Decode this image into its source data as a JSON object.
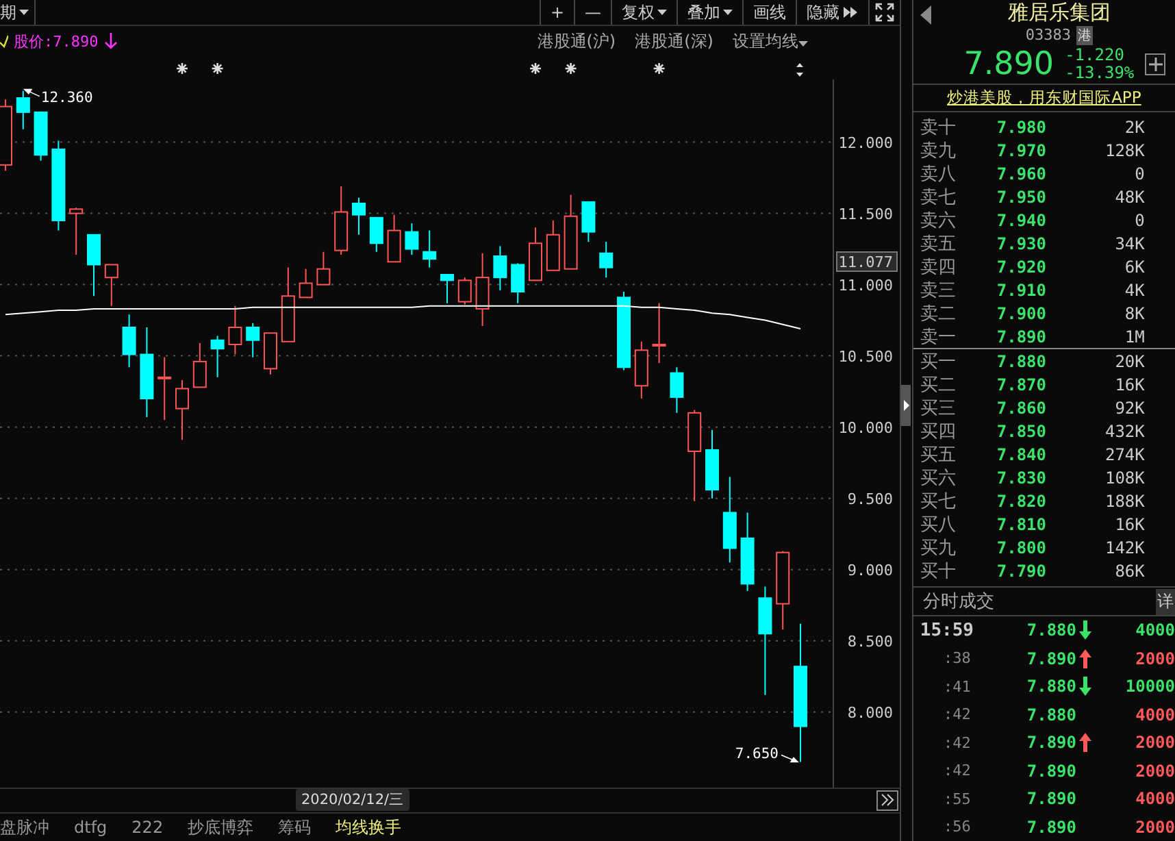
{
  "toolbar": {
    "period_dropdown": "期",
    "buttons": [
      {
        "label": "+",
        "kind": "plain"
      },
      {
        "label": "—",
        "kind": "plain"
      },
      {
        "label": "复权",
        "kind": "dropdown"
      },
      {
        "label": "叠加",
        "kind": "dropdown"
      },
      {
        "label": "画线",
        "kind": "plain"
      },
      {
        "label": "隐藏",
        "kind": "hide"
      },
      {
        "kind": "fullscreen"
      }
    ]
  },
  "legend": {
    "price_label": "股价:7.890",
    "links": [
      {
        "label": "港股通(沪)",
        "kind": "plain"
      },
      {
        "label": "港股通(深)",
        "kind": "plain"
      },
      {
        "label": "设置均线",
        "kind": "dropdown"
      }
    ]
  },
  "chart": {
    "chart_data": {
      "type": "candlestick",
      "grid": true,
      "ylim": [
        7.47,
        12.44
      ],
      "yticks": [
        {
          "value": 12,
          "label": "12.000"
        },
        {
          "value": 11.5,
          "label": "11.500"
        },
        {
          "value": 11,
          "label": "11.000"
        },
        {
          "value": 10.5,
          "label": "10.500"
        },
        {
          "value": 10,
          "label": "10.000"
        },
        {
          "value": 9.5,
          "label": "9.500"
        },
        {
          "value": 9,
          "label": "9.000"
        },
        {
          "value": 8.5,
          "label": "8.500"
        },
        {
          "value": 8,
          "label": "8.000"
        }
      ],
      "ohlc": [
        [
          11.84,
          12.3,
          11.8,
          12.25
        ],
        [
          12.31,
          12.36,
          12.09,
          12.21
        ],
        [
          12.21,
          12.21,
          11.87,
          11.91
        ],
        [
          11.95,
          12.01,
          11.38,
          11.45
        ],
        [
          11.5,
          11.54,
          11.21,
          11.53
        ],
        [
          11.35,
          11.35,
          10.92,
          11.14
        ],
        [
          11.05,
          11.14,
          10.85,
          11.14
        ],
        [
          10.7,
          10.79,
          10.42,
          10.51
        ],
        [
          10.51,
          10.7,
          10.07,
          10.2
        ],
        [
          10.35,
          10.49,
          10.05,
          10.35
        ],
        [
          10.13,
          10.33,
          9.91,
          10.27
        ],
        [
          10.28,
          10.59,
          10.28,
          10.46
        ],
        [
          10.61,
          10.64,
          10.35,
          10.55
        ],
        [
          10.58,
          10.85,
          10.51,
          10.7
        ],
        [
          10.7,
          10.73,
          10.49,
          10.61
        ],
        [
          10.41,
          10.66,
          10.37,
          10.66
        ],
        [
          10.6,
          11.12,
          10.6,
          10.92
        ],
        [
          10.91,
          11.11,
          10.91,
          11.01
        ],
        [
          11.0,
          11.23,
          11.0,
          11.11
        ],
        [
          11.24,
          11.69,
          11.21,
          11.51
        ],
        [
          11.57,
          11.61,
          11.35,
          11.49
        ],
        [
          11.47,
          11.47,
          11.23,
          11.29
        ],
        [
          11.16,
          11.49,
          11.16,
          11.38
        ],
        [
          11.37,
          11.43,
          11.21,
          11.25
        ],
        [
          11.23,
          11.38,
          11.12,
          11.18
        ],
        [
          11.07,
          11.07,
          10.87,
          11.03
        ],
        [
          10.88,
          11.05,
          10.86,
          11.03
        ],
        [
          10.83,
          11.22,
          10.71,
          11.05
        ],
        [
          11.2,
          11.27,
          10.96,
          11.05
        ],
        [
          11.14,
          11.15,
          10.87,
          10.95
        ],
        [
          11.03,
          11.4,
          11.03,
          11.29
        ],
        [
          11.1,
          11.45,
          11.1,
          11.35
        ],
        [
          11.11,
          11.63,
          11.11,
          11.48
        ],
        [
          11.58,
          11.58,
          11.3,
          11.37
        ],
        [
          11.22,
          11.3,
          11.05,
          11.12
        ],
        [
          10.91,
          10.95,
          10.4,
          10.42
        ],
        [
          10.29,
          10.6,
          10.2,
          10.54
        ],
        [
          10.58,
          10.87,
          10.45,
          10.58
        ],
        [
          10.38,
          10.42,
          10.1,
          10.21
        ],
        [
          9.83,
          10.12,
          9.48,
          10.1
        ],
        [
          9.84,
          9.98,
          9.5,
          9.56
        ],
        [
          9.4,
          9.65,
          9.05,
          9.15
        ],
        [
          9.22,
          9.4,
          8.85,
          8.9
        ],
        [
          8.8,
          8.88,
          8.12,
          8.55
        ],
        [
          8.76,
          9.13,
          8.58,
          9.12
        ],
        [
          8.32,
          8.62,
          7.65,
          7.9
        ]
      ],
      "series": [
        {
          "type": "line",
          "color": "#ffffff",
          "values": [
            10.79,
            10.8,
            10.81,
            10.82,
            10.82,
            10.83,
            10.83,
            10.83,
            10.83,
            10.83,
            10.83,
            10.83,
            10.83,
            10.83,
            10.84,
            10.84,
            10.84,
            10.84,
            10.84,
            10.84,
            10.84,
            10.84,
            10.84,
            10.84,
            10.85,
            10.85,
            10.85,
            10.85,
            10.85,
            10.85,
            10.85,
            10.85,
            10.85,
            10.85,
            10.85,
            10.85,
            10.84,
            10.84,
            10.83,
            10.82,
            10.8,
            10.79,
            10.77,
            10.75,
            10.72,
            10.69
          ]
        }
      ],
      "annotations": [
        {
          "text": "12.360"
        },
        {
          "text": "7.650"
        },
        {
          "text": "11.077"
        }
      ]
    }
  },
  "date_label": "2020/02/12/三",
  "bottom_tabs": [
    {
      "label": "盘脉冲",
      "selected": false
    },
    {
      "label": "dtfg",
      "selected": false
    },
    {
      "label": "222",
      "selected": false
    },
    {
      "label": "抄底博弈",
      "selected": false
    },
    {
      "label": "筹码",
      "selected": false
    },
    {
      "label": "均线换手",
      "selected": true
    }
  ],
  "quote": {
    "name": "雅居乐集团",
    "code": "03383",
    "market_badge": "港",
    "price": "7.890",
    "change": "-1.220",
    "change_pct": "-13.39%",
    "promo_link": "炒港美股，用东财国际APP"
  },
  "asks": [
    {
      "label": "卖十",
      "price": "7.980",
      "volume": "2K"
    },
    {
      "label": "卖九",
      "price": "7.970",
      "volume": "128K"
    },
    {
      "label": "卖八",
      "price": "7.960",
      "volume": "0"
    },
    {
      "label": "卖七",
      "price": "7.950",
      "volume": "48K"
    },
    {
      "label": "卖六",
      "price": "7.940",
      "volume": "0"
    },
    {
      "label": "卖五",
      "price": "7.930",
      "volume": "34K"
    },
    {
      "label": "卖四",
      "price": "7.920",
      "volume": "6K"
    },
    {
      "label": "卖三",
      "price": "7.910",
      "volume": "4K"
    },
    {
      "label": "卖二",
      "price": "7.900",
      "volume": "8K"
    },
    {
      "label": "卖一",
      "price": "7.890",
      "volume": "1M"
    }
  ],
  "bids": [
    {
      "label": "买一",
      "price": "7.880",
      "volume": "20K"
    },
    {
      "label": "买二",
      "price": "7.870",
      "volume": "16K"
    },
    {
      "label": "买三",
      "price": "7.860",
      "volume": "92K"
    },
    {
      "label": "买四",
      "price": "7.850",
      "volume": "432K"
    },
    {
      "label": "买五",
      "price": "7.840",
      "volume": "274K"
    },
    {
      "label": "买六",
      "price": "7.830",
      "volume": "108K"
    },
    {
      "label": "买七",
      "price": "7.820",
      "volume": "188K"
    },
    {
      "label": "买八",
      "price": "7.810",
      "volume": "16K"
    },
    {
      "label": "买九",
      "price": "7.800",
      "volume": "142K"
    },
    {
      "label": "买十",
      "price": "7.790",
      "volume": "86K"
    }
  ],
  "trades": {
    "title": "分时成交",
    "detail_button": "详",
    "rows": [
      {
        "time": "15:59",
        "kind": "full",
        "price": "7.880",
        "up_arrow": false,
        "down_arrow": true,
        "volume": "4000",
        "color": "#3ce36b"
      },
      {
        "time": ":38",
        "kind": "short",
        "price": "7.890",
        "up_arrow": true,
        "down_arrow": false,
        "volume": "2000",
        "color": "#ff5a5a"
      },
      {
        "time": ":41",
        "kind": "short",
        "price": "7.880",
        "up_arrow": false,
        "down_arrow": true,
        "volume": "10000",
        "color": "#3ce36b"
      },
      {
        "time": ":42",
        "kind": "short",
        "price": "7.880",
        "up_arrow": false,
        "down_arrow": false,
        "volume": "4000",
        "color": "#ff5a5a"
      },
      {
        "time": ":42",
        "kind": "short",
        "price": "7.890",
        "up_arrow": true,
        "down_arrow": false,
        "volume": "2000",
        "color": "#ff5a5a"
      },
      {
        "time": ":42",
        "kind": "short",
        "price": "7.890",
        "up_arrow": false,
        "down_arrow": false,
        "volume": "2000",
        "color": "#ff5a5a"
      },
      {
        "time": ":55",
        "kind": "short",
        "price": "7.890",
        "up_arrow": false,
        "down_arrow": false,
        "volume": "4000",
        "color": "#ff5a5a"
      },
      {
        "time": ":56",
        "kind": "short",
        "price": "7.890",
        "up_arrow": false,
        "down_arrow": false,
        "volume": "2000",
        "color": "#ff5a5a"
      }
    ]
  }
}
